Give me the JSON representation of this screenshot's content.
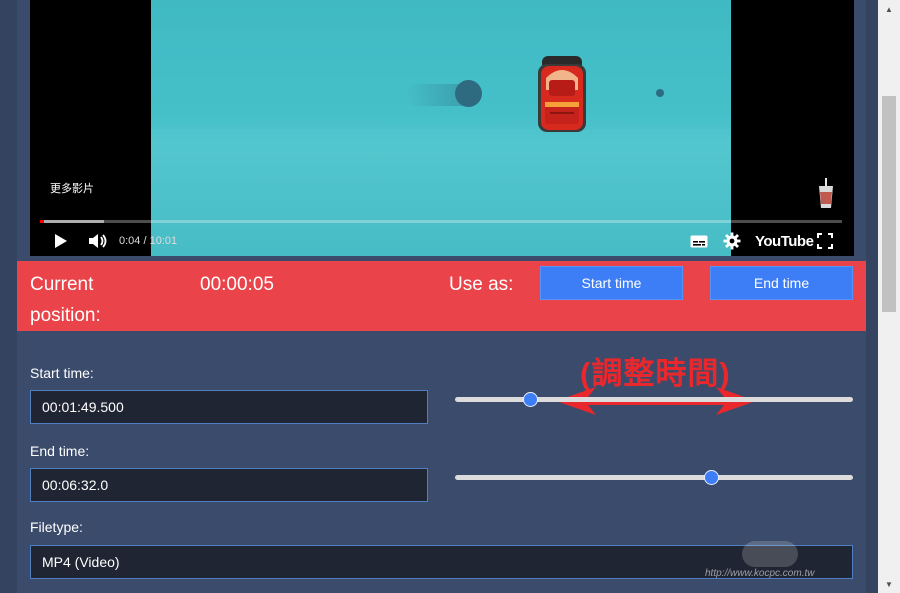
{
  "video": {
    "more_videos_label": "更多影片",
    "time_current": "0:04",
    "time_total": "10:01",
    "time_separator": "/",
    "logo_text": "YouTube",
    "progress_played_fraction": 0.005,
    "progress_loaded_fraction": 0.08
  },
  "position_bar": {
    "label": "Current position:",
    "value": "00:00:05",
    "use_as_label": "Use as:",
    "start_button": "Start time",
    "end_button": "End time",
    "background": "#ea434a",
    "button_color": "#3d7ef6"
  },
  "annotation": {
    "text": "(調整時間)",
    "color": "#e8282c"
  },
  "form": {
    "start_label": "Start time:",
    "start_value": "00:01:49.500",
    "start_slider_fraction": 0.19,
    "end_label": "End time:",
    "end_value": "00:06:32.0",
    "end_slider_fraction": 0.645,
    "filetype_label": "Filetype:",
    "filetype_value": "MP4 (Video)"
  },
  "watermark": {
    "text": "http://www.kocpc.com.tw"
  }
}
